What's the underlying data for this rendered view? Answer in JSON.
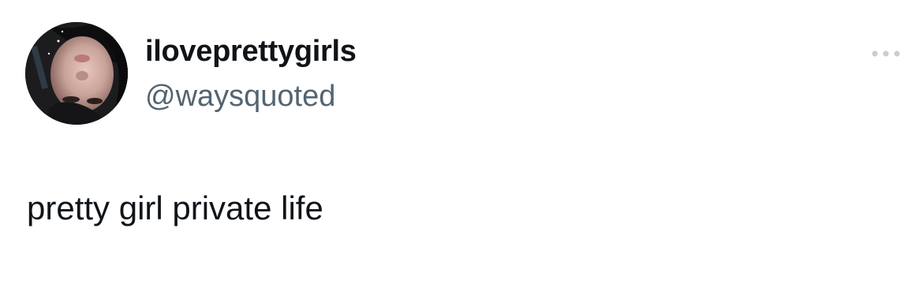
{
  "author": {
    "display_name": "iloveprettygirls",
    "handle": "@waysquoted"
  },
  "tweet": {
    "text": "pretty girl private life"
  },
  "icons": {
    "more": "more-options-icon",
    "avatar": "avatar-photo"
  },
  "colors": {
    "text_primary": "#0f1419",
    "text_secondary": "#536471",
    "icon_muted": "#c8cdd2",
    "background": "#ffffff"
  }
}
